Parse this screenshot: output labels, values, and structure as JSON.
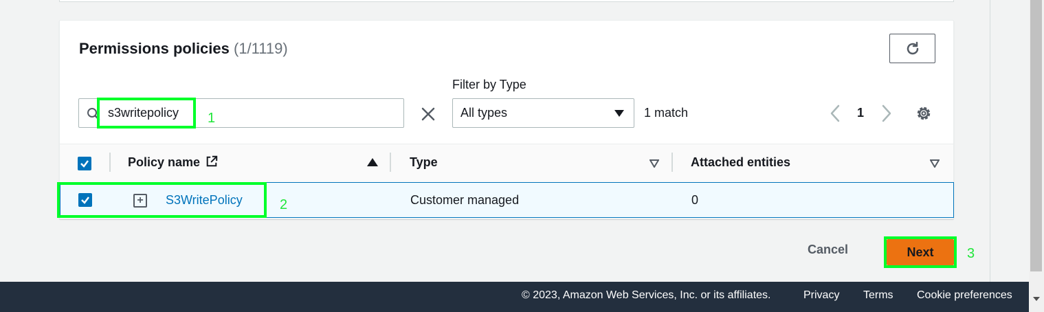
{
  "panel": {
    "title": "Permissions policies",
    "count": "(1/1119)"
  },
  "filter": {
    "label": "Filter by Type",
    "search_value": "s3writepolicy",
    "type_value": "All types",
    "match_text": "1 match"
  },
  "pagination": {
    "current_page": "1"
  },
  "table": {
    "columns": [
      "Policy name",
      "Type",
      "Attached entities"
    ],
    "rows": [
      {
        "policy_name": "S3WritePolicy",
        "type": "Customer managed",
        "attached_entities": "0",
        "selected": true
      }
    ]
  },
  "annotations": {
    "step1": "1",
    "step2": "2",
    "step3": "3",
    "highlight_color": "#00ff2a"
  },
  "actions": {
    "cancel_label": "Cancel",
    "next_label": "Next"
  },
  "footer": {
    "copyright": "© 2023, Amazon Web Services, Inc. or its affiliates.",
    "privacy": "Privacy",
    "terms": "Terms",
    "cookie": "Cookie preferences"
  },
  "colors": {
    "accent": "#0073bb",
    "primary_button": "#ec7211",
    "footer_bg": "#232f3e"
  }
}
